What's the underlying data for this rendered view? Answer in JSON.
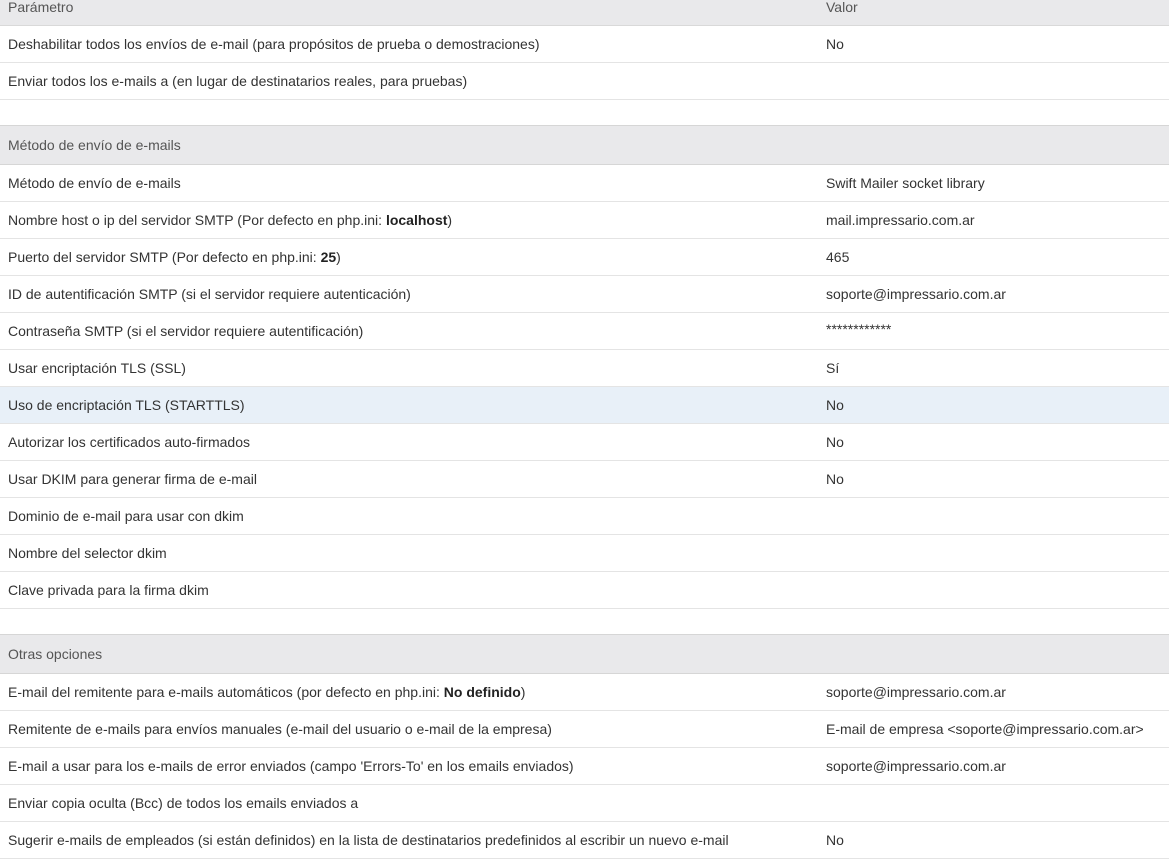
{
  "header": {
    "param": "Parámetro",
    "value": "Valor"
  },
  "section1": [
    {
      "label": "Deshabilitar todos los envíos de e-mail (para propósitos de prueba o demostraciones)",
      "value": "No"
    },
    {
      "label": "Enviar todos los e-mails a (en lugar de destinatarios reales, para pruebas)",
      "value": ""
    }
  ],
  "section2": {
    "title": "Método de envío de e-mails",
    "rows": [
      {
        "label": "Método de envío de e-mails",
        "value": "Swift Mailer socket library"
      },
      {
        "label_pre": "Nombre host o ip del servidor SMTP (Por defecto en php.ini: ",
        "label_bold": "localhost",
        "label_post": ")",
        "value": "mail.impressario.com.ar"
      },
      {
        "label_pre": "Puerto del servidor SMTP (Por defecto en php.ini: ",
        "label_bold": "25",
        "label_post": ")",
        "value": "465"
      },
      {
        "label": "ID de autentificación SMTP (si el servidor requiere autenticación)",
        "value": "soporte@impressario.com.ar"
      },
      {
        "label": "Contraseña SMTP (si el servidor requiere autentificación)",
        "value": "************"
      },
      {
        "label": "Usar encriptación TLS (SSL)",
        "value": "Sí"
      },
      {
        "label": "Uso de encriptación TLS (STARTTLS)",
        "value": "No"
      },
      {
        "label": "Autorizar los certificados auto-firmados",
        "value": "No"
      },
      {
        "label": "Usar DKIM para generar firma de e-mail",
        "value": "No"
      },
      {
        "label": "Dominio de e-mail para usar con dkim",
        "value": ""
      },
      {
        "label": "Nombre del selector dkim",
        "value": ""
      },
      {
        "label": "Clave privada para la firma dkim",
        "value": ""
      }
    ]
  },
  "section3": {
    "title": "Otras opciones",
    "rows": [
      {
        "label_pre": "E-mail del remitente para e-mails automáticos (por defecto en php.ini: ",
        "label_bold": "No definido",
        "label_post": ")",
        "value": "soporte@impressario.com.ar"
      },
      {
        "label": "Remitente de e-mails para envíos manuales (e-mail del usuario o e-mail de la empresa)",
        "value": "E-mail de empresa <soporte@impressario.com.ar>"
      },
      {
        "label": "E-mail a usar para los e-mails de error enviados (campo 'Errors-To' en los emails enviados)",
        "value": "soporte@impressario.com.ar"
      },
      {
        "label": "Enviar copia oculta (Bcc) de todos los emails enviados a",
        "value": ""
      },
      {
        "label": "Sugerir e-mails de empleados (si están definidos) en la lista de destinatarios predefinidos al escribir un nuevo e-mail",
        "value": "No"
      }
    ]
  }
}
